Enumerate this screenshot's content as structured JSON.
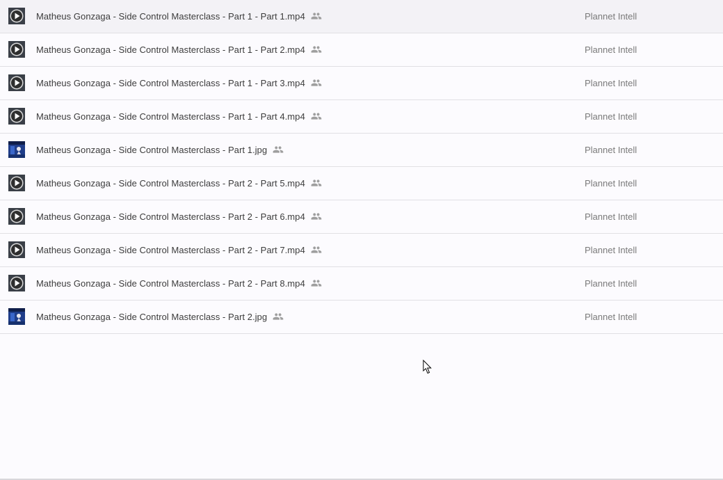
{
  "files": [
    {
      "name": "Matheus Gonzaga - Side Control Masterclass - Part 1 - Part 1.mp4",
      "type": "video",
      "thumb_icon": "video-play-icon",
      "shared_icon": "people-icon",
      "owner": "Plannet Intell"
    },
    {
      "name": "Matheus Gonzaga - Side Control Masterclass - Part 1 - Part 2.mp4",
      "type": "video",
      "thumb_icon": "video-play-icon",
      "shared_icon": "people-icon",
      "owner": "Plannet Intell"
    },
    {
      "name": "Matheus Gonzaga - Side Control Masterclass - Part 1 - Part 3.mp4",
      "type": "video",
      "thumb_icon": "video-play-icon",
      "shared_icon": "people-icon",
      "owner": "Plannet Intell"
    },
    {
      "name": "Matheus Gonzaga - Side Control Masterclass - Part 1 - Part 4.mp4",
      "type": "video",
      "thumb_icon": "video-play-icon",
      "shared_icon": "people-icon",
      "owner": "Plannet Intell"
    },
    {
      "name": "Matheus Gonzaga - Side Control Masterclass - Part 1.jpg",
      "type": "image",
      "thumb_icon": "image-thumbnail-icon",
      "shared_icon": "people-icon",
      "owner": "Plannet Intell"
    },
    {
      "name": "Matheus Gonzaga - Side Control Masterclass - Part 2 - Part 5.mp4",
      "type": "video",
      "thumb_icon": "video-play-icon",
      "shared_icon": "people-icon",
      "owner": "Plannet Intell"
    },
    {
      "name": "Matheus Gonzaga - Side Control Masterclass - Part 2 - Part 6.mp4",
      "type": "video",
      "thumb_icon": "video-play-icon",
      "shared_icon": "people-icon",
      "owner": "Plannet Intell"
    },
    {
      "name": "Matheus Gonzaga - Side Control Masterclass - Part 2 - Part 7.mp4",
      "type": "video",
      "thumb_icon": "video-play-icon",
      "shared_icon": "people-icon",
      "owner": "Plannet Intell"
    },
    {
      "name": "Matheus Gonzaga - Side Control Masterclass - Part 2 - Part 8.mp4",
      "type": "video",
      "thumb_icon": "video-play-icon",
      "shared_icon": "people-icon",
      "owner": "Plannet Intell"
    },
    {
      "name": "Matheus Gonzaga - Side Control Masterclass - Part 2.jpg",
      "type": "image",
      "thumb_icon": "image-thumbnail-icon",
      "shared_icon": "people-icon",
      "owner": "Plannet Intell"
    }
  ],
  "colors": {
    "background": "#fcfbfe",
    "row_divider": "#e1e0e4",
    "file_name_text": "#3c3c3c",
    "owner_text": "#7a7a7a",
    "shared_icon": "#9e9e9e",
    "image_thumb_blue": "#1f3d8a"
  },
  "cursor_icon": "mouse-pointer-icon"
}
